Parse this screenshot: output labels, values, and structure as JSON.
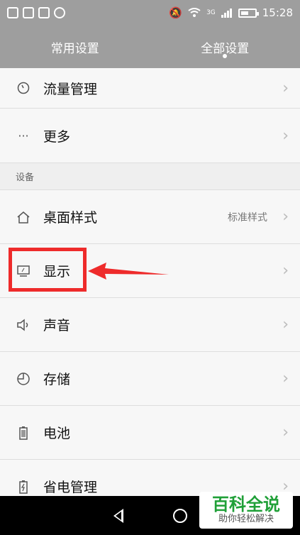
{
  "status": {
    "time": "15:28",
    "network": "3G"
  },
  "tabs": [
    {
      "label": "常用设置",
      "active": false
    },
    {
      "label": "全部设置",
      "active": true
    }
  ],
  "list": {
    "rows_top": [
      {
        "label": "流量管理",
        "icon": "gauge-icon"
      },
      {
        "label": "更多",
        "icon": "more-dots-icon"
      }
    ],
    "section_label": "设备",
    "rows_device": [
      {
        "label": "桌面样式",
        "value": "标准样式",
        "icon": "home-icon"
      },
      {
        "label": "显示",
        "icon": "display-icon"
      },
      {
        "label": "声音",
        "icon": "speaker-icon"
      },
      {
        "label": "存储",
        "icon": "storage-pie-icon"
      },
      {
        "label": "电池",
        "icon": "battery-icon"
      },
      {
        "label": "省电管理",
        "icon": "battery-charge-icon"
      }
    ]
  },
  "annotation": {
    "color": "#ee2b2b"
  },
  "watermark": {
    "title": "百科全说",
    "subtitle": "助你轻松解决"
  },
  "colors": {
    "header": "#9e9e9e",
    "accent_red": "#ee2b2b",
    "watermark_green": "#20a038"
  }
}
